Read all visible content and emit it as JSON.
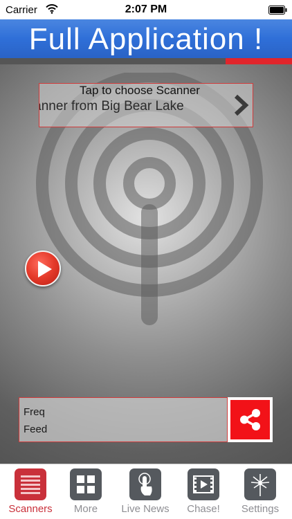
{
  "status_bar": {
    "carrier": "Carrier",
    "time": "2:07 PM"
  },
  "banner": {
    "title": "Full Application !"
  },
  "scanner_picker": {
    "label": "Tap to choose Scanner",
    "value": "Scanner from Big Bear Lake"
  },
  "info_panel": {
    "freq_label": "Freq",
    "feed_label": "Feed"
  },
  "tabs": [
    {
      "label": "Scanners",
      "icon": "list-icon",
      "active": true
    },
    {
      "label": "More",
      "icon": "grid-icon",
      "active": false
    },
    {
      "label": "Live News",
      "icon": "touch-icon",
      "active": false
    },
    {
      "label": "Chase!",
      "icon": "film-icon",
      "active": false
    },
    {
      "label": "Settings",
      "icon": "sparkle-icon",
      "active": false
    }
  ],
  "colors": {
    "accent_red": "#c9303a",
    "banner_blue": "#2f6fd8",
    "share_red": "#f21218"
  }
}
